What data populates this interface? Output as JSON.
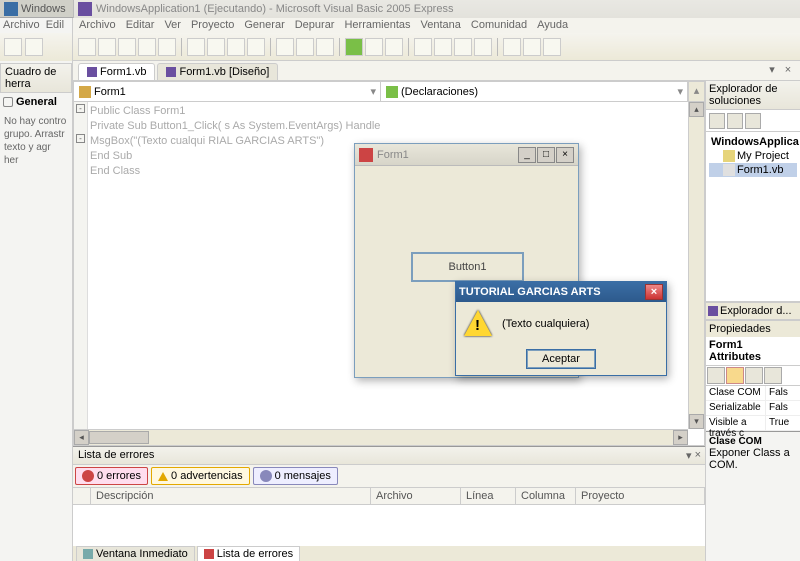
{
  "outerTitle": "Windows",
  "mainTitle": "WindowsApplication1 (Ejecutando) - Microsoft Visual Basic 2005 Express",
  "leftMenu": [
    "Archivo",
    "Edil"
  ],
  "leftPanel": {
    "title": "Cuadro de herra",
    "group": "General",
    "hint": "No hay contro\ngrupo. Arrastr\ntexto y agr\nher"
  },
  "mainMenu": [
    "Archivo",
    "Editar",
    "Ver",
    "Proyecto",
    "Generar",
    "Depurar",
    "Herramientas",
    "Ventana",
    "Comunidad",
    "Ayuda"
  ],
  "docTabs": [
    {
      "label": "Form1.vb",
      "active": true
    },
    {
      "label": "Form1.vb [Diseño]",
      "active": false
    }
  ],
  "dropdowns": {
    "left": "Form1",
    "right": "(Declaraciones)"
  },
  "code": [
    "Public Class Form1",
    "",
    "    Private Sub Button1_Click(                                         s As System.EventArgs) Handle",
    "        MsgBox(\"(Texto cualqui                                        RIAL GARCIAS ARTS\")",
    "    End Sub",
    "End Class"
  ],
  "formWindow": {
    "title": "Form1",
    "button": "Button1"
  },
  "msgBox": {
    "title": "TUTORIAL GARCIAS ARTS",
    "text": "(Texto cualquiera)",
    "ok": "Aceptar"
  },
  "errorList": {
    "title": "Lista de errores",
    "tabs": {
      "errors": "0 errores",
      "warnings": "0 advertencias",
      "messages": "0 mensajes"
    },
    "cols": [
      "",
      "Descripción",
      "Archivo",
      "Línea",
      "Columna",
      "Proyecto"
    ]
  },
  "bottomTabs": [
    {
      "label": "Ventana Inmediato"
    },
    {
      "label": "Lista de errores"
    }
  ],
  "solutionExplorer": {
    "title": "Explorador de soluciones",
    "root": "WindowsApplica",
    "children": [
      "My Project",
      "Form1.vb"
    ],
    "tab": "Explorador d..."
  },
  "properties": {
    "title": "Propiedades",
    "object": "Form1 Attributes",
    "rows": [
      {
        "k": "Clase COM",
        "v": "Fals"
      },
      {
        "k": "Serializable",
        "v": "Fals"
      },
      {
        "k": "Visible a través c",
        "v": "True"
      }
    ],
    "descTitle": "Clase COM",
    "descBody": "Exponer Class a COM."
  }
}
